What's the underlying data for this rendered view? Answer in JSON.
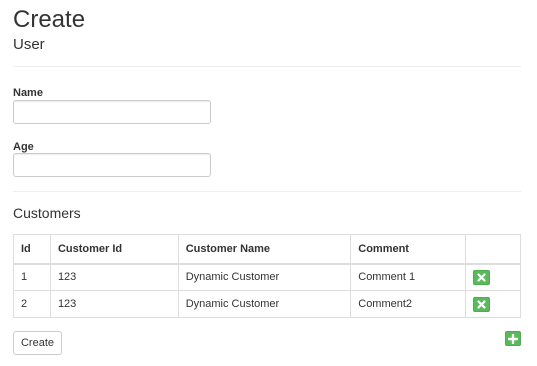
{
  "header": {
    "title": "Create",
    "subtitle": "User"
  },
  "form": {
    "name_label": "Name",
    "name_value": "",
    "name_placeholder": "",
    "age_label": "Age",
    "age_value": "",
    "age_placeholder": ""
  },
  "customers": {
    "section_title": "Customers",
    "columns": [
      "Id",
      "Customer Id",
      "Customer Name",
      "Comment",
      ""
    ],
    "rows": [
      {
        "id": "1",
        "customer_id": "123",
        "customer_name": "Dynamic Customer",
        "comment": "Comment 1",
        "action_icon": "remove-icon"
      },
      {
        "id": "2",
        "customer_id": "123",
        "customer_name": "Dynamic Customer",
        "comment": "Comment2",
        "action_icon": "remove-icon"
      }
    ],
    "add_icon": "plus-icon"
  },
  "actions": {
    "create_label": "Create"
  },
  "colors": {
    "success": "#5cb85c",
    "border": "#dddddd",
    "text": "#333333"
  }
}
